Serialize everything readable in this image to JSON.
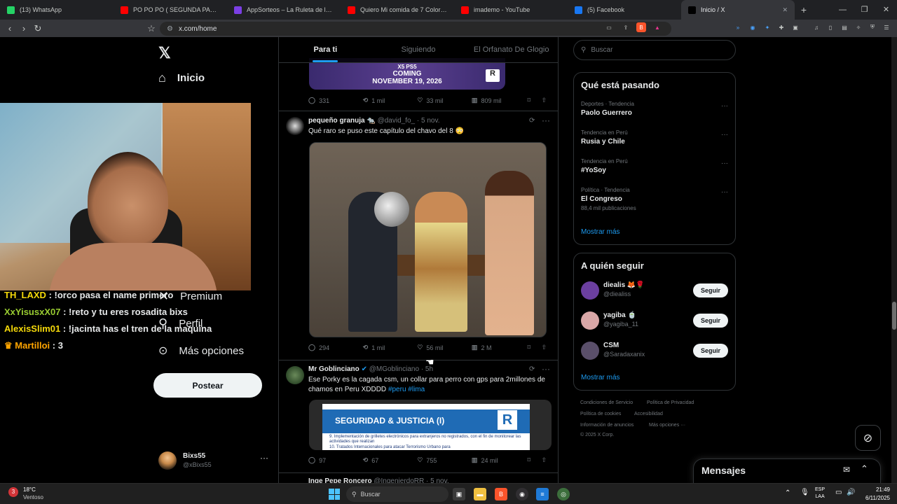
{
  "browser": {
    "tabs": [
      {
        "label": "(13) WhatsApp",
        "color": "#25d366",
        "active": false
      },
      {
        "label": "PO PO PO ( SEGUNDA PARTE ) -",
        "color": "#ff0000",
        "active": false
      },
      {
        "label": "AppSorteos – La Ruleta de la Suerte",
        "color": "#7b3fe4",
        "active": false
      },
      {
        "label": "Quiero Mi comida de 7 Colores",
        "color": "#ff0000",
        "active": false
      },
      {
        "label": "imademo - YouTube",
        "color": "#ff0000",
        "active": false
      },
      {
        "label": "(5) Facebook",
        "color": "#1877f2",
        "active": false
      },
      {
        "label": "Inicio / X",
        "color": "#000000",
        "active": true
      }
    ],
    "url": "x.com/home"
  },
  "x_nav": {
    "home": "Inicio",
    "premium": "Premium",
    "profile": "Perfil",
    "more": "Más opciones",
    "post_button": "Postear",
    "user_name": "Bixs55",
    "user_handle": "@xBixs55"
  },
  "chat": [
    {
      "user": "TH_LAXD",
      "msg": "!orco pasa el name primero",
      "color": "#f5d90a"
    },
    {
      "user": "XxYisusxX07",
      "msg": "!reto y tu eres rosadita bixs",
      "color": "#9acd32"
    },
    {
      "user": "AlexisSlim01",
      "msg": "!jacinta has el tren de la maquina",
      "color": "#f5d90a"
    },
    {
      "user": "Martilloi",
      "msg": "3",
      "color": "#ffa500"
    }
  ],
  "feed": {
    "tabs": [
      "Para ti",
      "Siguiendo",
      "El Orfanato De Glogio"
    ],
    "promo": {
      "line1": "X5 PS5",
      "line2": "COMING",
      "line3": "NOVEMBER 19, 2026",
      "logo": "R"
    },
    "post0_actions": {
      "replies": "331",
      "reposts": "1 mil",
      "likes": "33 mil",
      "views": "809 mil"
    },
    "post1": {
      "name": "pequeño granuja",
      "emoji": "🐀",
      "handle": "@david_fo_",
      "time": "· 5 nov.",
      "text": "Qué raro se puso este capítulo del chavo del 8 😳",
      "replies": "294",
      "reposts": "1 mil",
      "likes": "56 mil",
      "views": "2 M"
    },
    "post2": {
      "name": "Mr Goblinciano",
      "handle": "@MGoblinciano",
      "time": "· 5h",
      "text": "Ese Porky es la cagada csm, un collar para perro con gps para 2millones de chamos en Peru XDDDD",
      "tags": "#peru #lima",
      "image_title": "SEGURIDAD & JUSTICIA (I)",
      "image_logo": "R",
      "image_item9": "9.  Implementación de grilletes electrónicos para extranjeros no registrados, con el fin de monitorear las actividades que realizan",
      "image_item10": "10. Tratados Internacionales para atacar Terrorismo Urbano para",
      "replies": "97",
      "reposts": "67",
      "likes": "755",
      "views": "24 mil"
    },
    "post3": {
      "name": "Inge Pepe Roncero",
      "handle": "@IngenierdoRR",
      "time": "· 5 nov."
    }
  },
  "right": {
    "search_placeholder": "Buscar",
    "trends_title": "Qué está pasando",
    "trends": [
      {
        "meta": "Deportes · Tendencia",
        "name": "Paolo Guerrero",
        "posts": ""
      },
      {
        "meta": "Tendencia en Perú",
        "name": "Rusia y Chile",
        "posts": ""
      },
      {
        "meta": "Tendencia en Perú",
        "name": "#YoSoy",
        "posts": ""
      },
      {
        "meta": "Política · Tendencia",
        "name": "El Congreso",
        "posts": "88,4 mil publicaciones"
      }
    ],
    "show_more": "Mostrar más",
    "who_title": "A quién seguir",
    "who": [
      {
        "name": "diealis 🦊🌹",
        "handle": "@diealiss",
        "btn": "Seguir",
        "color": "#6b3fa0"
      },
      {
        "name": "yagiba 🍵",
        "handle": "@yagiba_11",
        "btn": "Seguir",
        "color": "#d9a7a7"
      },
      {
        "name": "CSM",
        "handle": "@Saradaxanix",
        "btn": "Seguir",
        "color": "#5a4f6a"
      }
    ],
    "who_more": "Mostrar más",
    "footer": [
      "Condiciones de Servicio",
      "Política de Privacidad",
      "Política de cookies",
      "Accesibilidad",
      "Información de anuncios",
      "Más opciones ···",
      "© 2025 X Corp."
    ],
    "messages": "Mensajes"
  },
  "taskbar": {
    "temp": "18°C",
    "weather": "Ventoso",
    "search": "Buscar",
    "lang1": "ESP",
    "lang2": "LAA",
    "time": "21:49",
    "date": "6/11/2025",
    "badge": "3"
  }
}
